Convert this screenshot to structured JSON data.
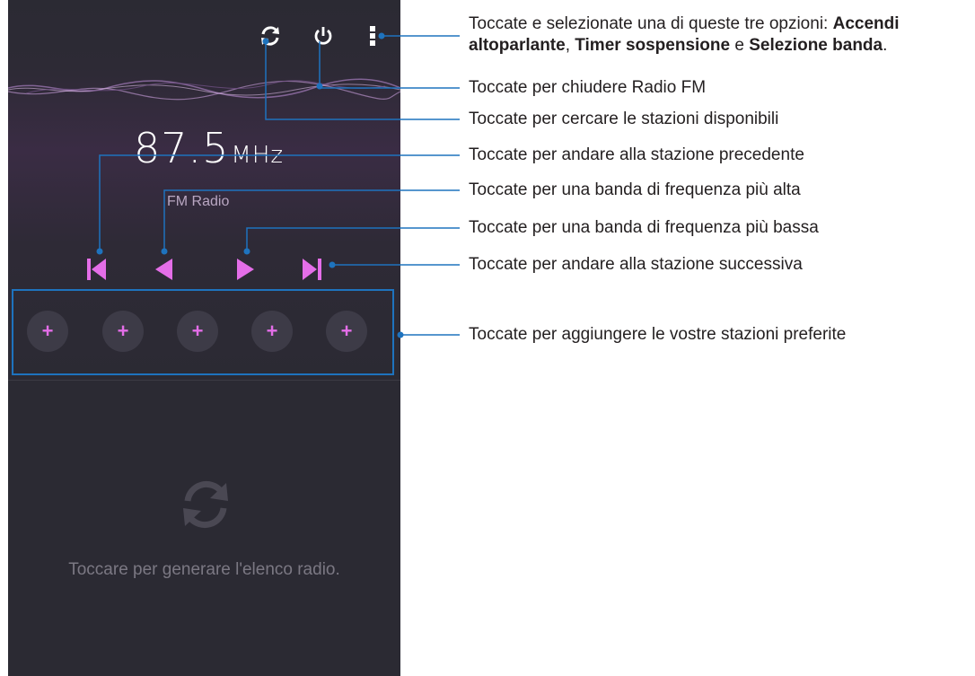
{
  "player": {
    "frequency": "87.5",
    "unit": "MHz",
    "station_name": "FM Radio",
    "favorites": [
      "+",
      "+",
      "+",
      "+",
      "+"
    ],
    "empty_list_text": "Toccare per generare l'elenco radio."
  },
  "colors": {
    "accent": "#e46ee8",
    "callout_line": "#1e73be",
    "phone_background": "#2b2a33"
  },
  "callouts": {
    "menu": {
      "prefix": "Toccate e selezionate una di queste tre opzioni: ",
      "opt1_line1": "Accendi",
      "opt1_line2": "altoparlante",
      "sep1": ", ",
      "opt2": "Timer sospensione",
      "sep2": " e ",
      "opt3": "Selezione banda",
      "suffix": "."
    },
    "power": "Toccate per chiudere Radio FM",
    "scan": "Toccate per cercare le stazioni disponibili",
    "previous_station": "Toccate per andare alla stazione precedente",
    "higher_band": "Toccate per una banda di frequenza più alta",
    "lower_band": "Toccate per una banda di frequenza più bassa",
    "next_station": "Toccate per andare alla stazione successiva",
    "favorites": "Toccate per aggiungere le vostre stazioni preferite"
  }
}
